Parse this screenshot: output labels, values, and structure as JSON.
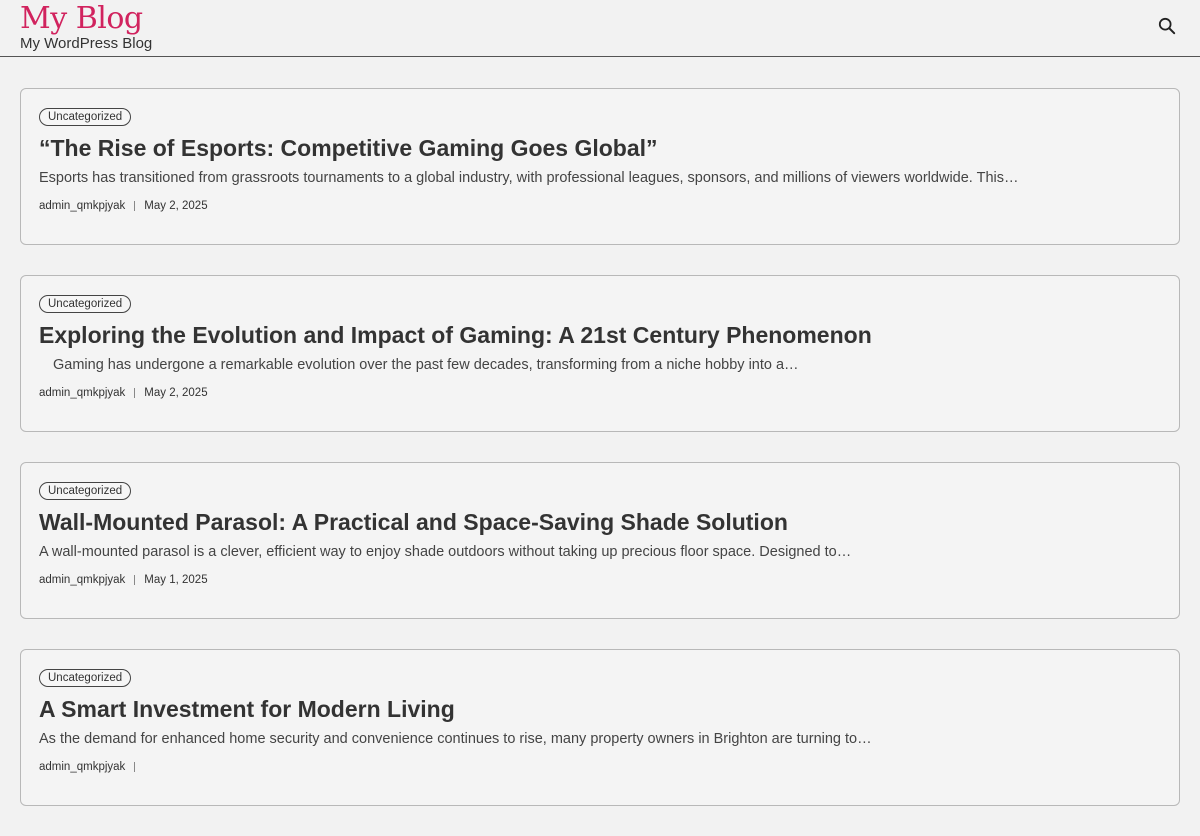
{
  "header": {
    "site_title": "My Blog",
    "tagline": "My WordPress Blog",
    "search_icon": "search-icon"
  },
  "posts": [
    {
      "category": "Uncategorized",
      "title": "“The Rise of Esports: Competitive Gaming Goes Global”",
      "excerpt": "Esports has transitioned from grassroots tournaments to a global industry, with professional leagues, sponsors, and millions of viewers worldwide. This…",
      "author": "admin_qmkpjyak",
      "date": "May 2, 2025"
    },
    {
      "category": "Uncategorized",
      "title": "Exploring the Evolution and Impact of Gaming: A 21st Century Phenomenon",
      "excerpt": "Gaming has undergone a remarkable evolution over the past few decades, transforming from a niche hobby into a…",
      "author": "admin_qmkpjyak",
      "date": "May 2, 2025"
    },
    {
      "category": "Uncategorized",
      "title": "Wall-Mounted Parasol: A Practical and Space-Saving Shade Solution",
      "excerpt": "A wall-mounted parasol is a clever, efficient way to enjoy shade outdoors without taking up precious floor space. Designed to…",
      "author": "admin_qmkpjyak",
      "date": "May 1, 2025"
    },
    {
      "category": "Uncategorized",
      "title": "A Smart Investment for Modern Living",
      "excerpt": "As the demand for enhanced home security and convenience continues to rise, many property owners in Brighton are turning to…",
      "author": "admin_qmkpjyak",
      "date": ""
    }
  ],
  "colors": {
    "brand": "#d1235e",
    "text": "#333333",
    "background": "#f2f2f2"
  }
}
